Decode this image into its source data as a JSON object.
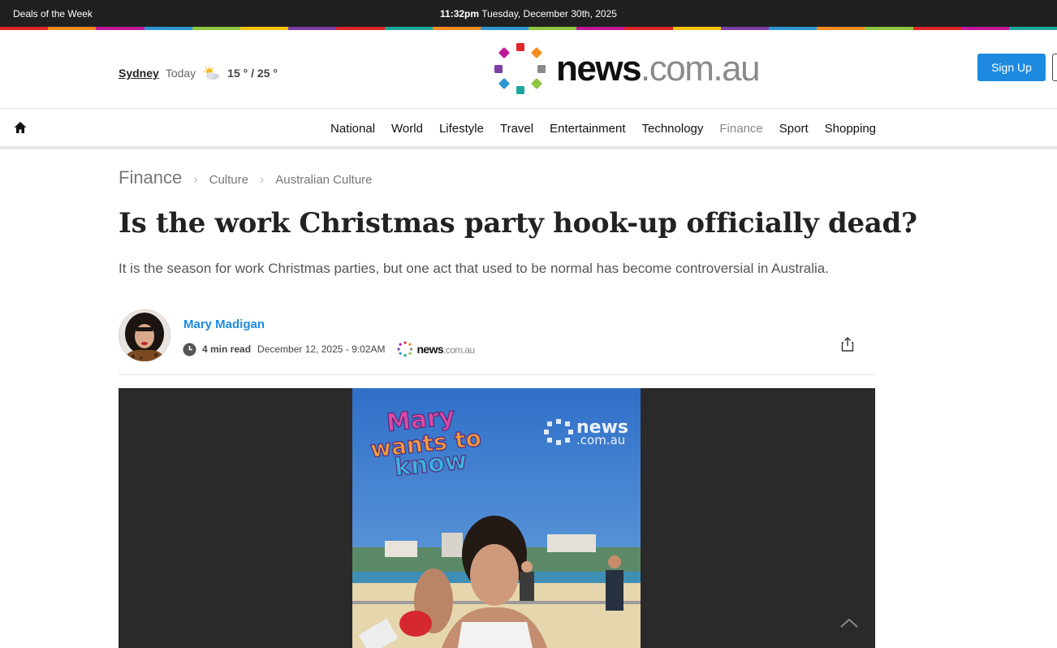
{
  "topbar": {
    "deals": "Deals of the Week",
    "time": "11:32pm",
    "date": "Tuesday, December 30th, 2025"
  },
  "stripe_colors": [
    "#e0252b",
    "#f68b1f",
    "#c1179b",
    "#2d96d5",
    "#8dc63f",
    "#f4c20d",
    "#7a3fa5",
    "#e0252b",
    "#1aa89c",
    "#f68b1f",
    "#2d96d5",
    "#8dc63f",
    "#c1179b",
    "#e0252b",
    "#f4c20d",
    "#7a3fa5",
    "#2d96d5",
    "#f68b1f",
    "#8dc63f",
    "#e0252b",
    "#c1179b",
    "#1aa89c"
  ],
  "weather": {
    "city": "Sydney",
    "label": "Today",
    "temps": "15 ° / 25 °",
    "icon": "partly-cloudy-icon"
  },
  "logo": {
    "main": "news",
    "suffix": ".com.au"
  },
  "header": {
    "signup": "Sign Up"
  },
  "nav": {
    "home_icon": "home-icon",
    "items": [
      "National",
      "World",
      "Lifestyle",
      "Travel",
      "Entertainment",
      "Technology",
      "Finance",
      "Sport",
      "Shopping"
    ],
    "active": "Finance"
  },
  "breadcrumb": [
    "Finance",
    "Culture",
    "Australian Culture"
  ],
  "article": {
    "headline": "Is the work Christmas party hook-up officially dead?",
    "standfirst": "It is the season for work Christmas parties, but one act that used to be normal has become controversial in Australia.",
    "author": "Mary Madigan",
    "read_time": "4 min read",
    "published": "December 12, 2025 - 9:02AM",
    "source_logo": {
      "main": "news",
      "suffix": ".com.au"
    }
  },
  "video": {
    "overlay_title": [
      "Mary",
      "wants to",
      "know"
    ],
    "watermark": {
      "main": "news",
      "suffix": ".com.au"
    }
  },
  "colors": {
    "accent": "#1d8ae0",
    "topbar": "#202020"
  }
}
